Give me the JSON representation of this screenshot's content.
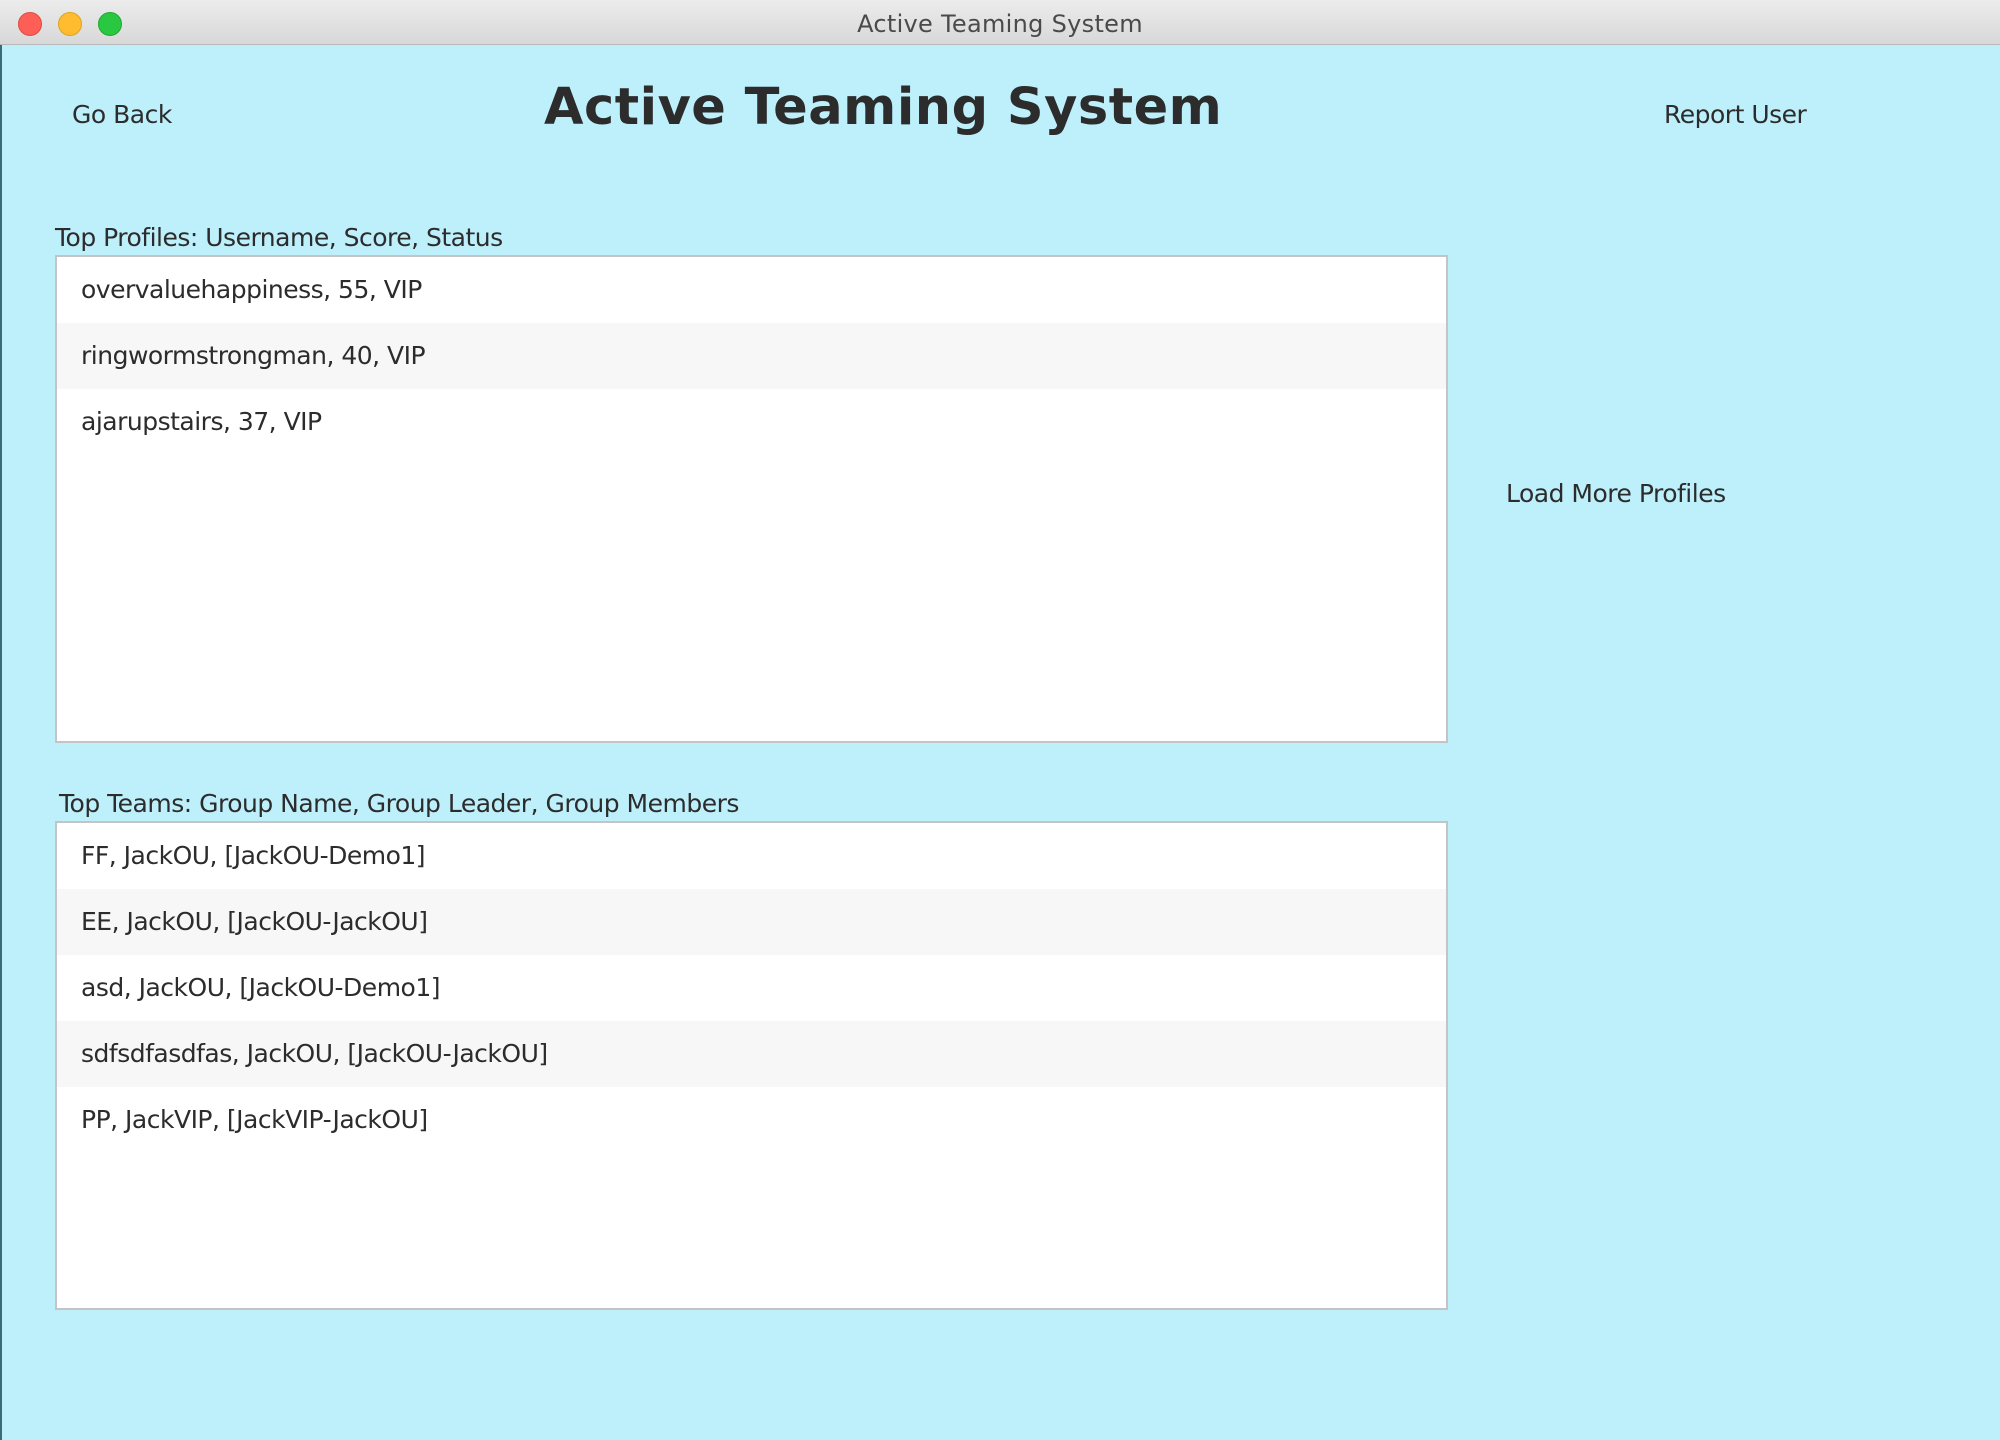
{
  "window": {
    "title": "Active Teaming System"
  },
  "header": {
    "go_back_label": "Go Back",
    "app_title": "Active Teaming System",
    "report_user_label": "Report User"
  },
  "profiles": {
    "label": "Top Profiles: Username, Score, Status",
    "items": [
      "overvaluehappiness, 55, VIP",
      "ringwormstrongman, 40, VIP",
      "ajarupstairs, 37, VIP"
    ],
    "load_more_label": "Load More Profiles"
  },
  "teams": {
    "label": "Top Teams: Group Name, Group Leader, Group Members",
    "items": [
      "FF, JackOU, [JackOU-Demo1]",
      "EE, JackOU, [JackOU-JackOU]",
      "asd, JackOU, [JackOU-Demo1]",
      "sdfsdfasdfas, JackOU, [JackOU-JackOU]",
      "PP, JackVIP, [JackVIP-JackOU]"
    ]
  },
  "colors": {
    "background": "#bef0fc",
    "list_background": "#ffffff",
    "list_alt_row": "#f7f7f7",
    "text": "#2c2c2c"
  }
}
